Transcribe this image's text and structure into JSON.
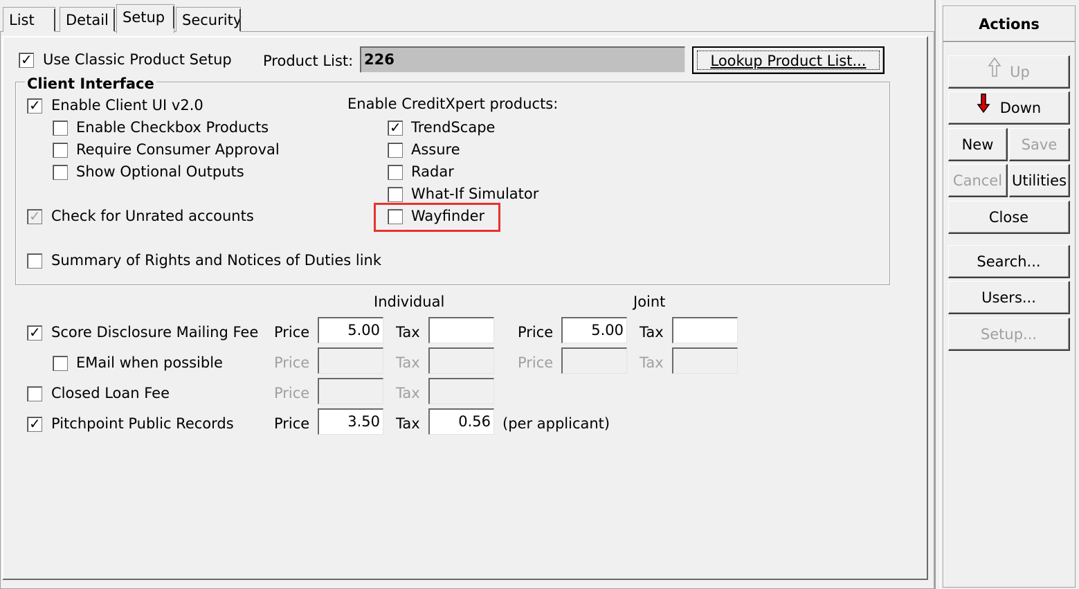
{
  "tabs": [
    "List",
    "Detail",
    "Setup",
    "Security"
  ],
  "setup": {
    "use_classic": {
      "label": "Use Classic Product Setup",
      "checked": true
    },
    "product_list_label": "Product List:",
    "product_list_value": "226",
    "lookup_button": "Lookup Product List..."
  },
  "client_interface": {
    "title": "Client Interface",
    "enable_client_ui": {
      "label": "Enable Client UI v2.0",
      "checked": true
    },
    "enable_checkbox_products": {
      "label": "Enable Checkbox Products",
      "checked": false
    },
    "require_consumer_approval": {
      "label": "Require Consumer Approval",
      "checked": false
    },
    "show_optional_outputs": {
      "label": "Show Optional Outputs",
      "checked": false
    },
    "check_unrated": {
      "label": "Check for Unrated accounts",
      "checked": true
    },
    "summary_rights": {
      "label": "Summary of Rights and Notices of Duties link",
      "checked": false
    },
    "creditxpert_label": "Enable CreditXpert products:",
    "creditxpert": [
      {
        "label": "TrendScape",
        "checked": true
      },
      {
        "label": "Assure",
        "checked": false
      },
      {
        "label": "Radar",
        "checked": false
      },
      {
        "label": "What-If Simulator",
        "checked": false
      },
      {
        "label": "Wayfinder",
        "checked": false
      }
    ]
  },
  "fees": {
    "individual_header": "Individual",
    "joint_header": "Joint",
    "price_label": "Price",
    "tax_label": "Tax",
    "per_applicant": "(per applicant)",
    "rows": [
      {
        "label": "Score Disclosure Mailing Fee",
        "checked": true,
        "ind_price": "5.00",
        "ind_tax": "",
        "joint_price": "5.00",
        "joint_tax": ""
      },
      {
        "label": "EMail when possible",
        "checked": false,
        "ind_price": "",
        "ind_tax": "",
        "joint_price": "",
        "joint_tax": ""
      },
      {
        "label": "Closed Loan Fee",
        "checked": false,
        "ind_price": "",
        "ind_tax": ""
      },
      {
        "label": "Pitchpoint Public Records",
        "checked": true,
        "ind_price": "3.50",
        "ind_tax": "0.56"
      }
    ]
  },
  "actions": {
    "title": "Actions",
    "up": "Up",
    "down": "Down",
    "new": "New",
    "save": "Save",
    "cancel": "Cancel",
    "utilities": "Utilities",
    "close": "Close",
    "search": "Search...",
    "users": "Users...",
    "setup": "Setup..."
  },
  "icons": {
    "check": "✓",
    "arrow_up": "arrow-up-outline",
    "arrow_down": "arrow-down-red"
  },
  "colors": {
    "highlight": "#e8322b",
    "down_arrow": "#e00000"
  }
}
